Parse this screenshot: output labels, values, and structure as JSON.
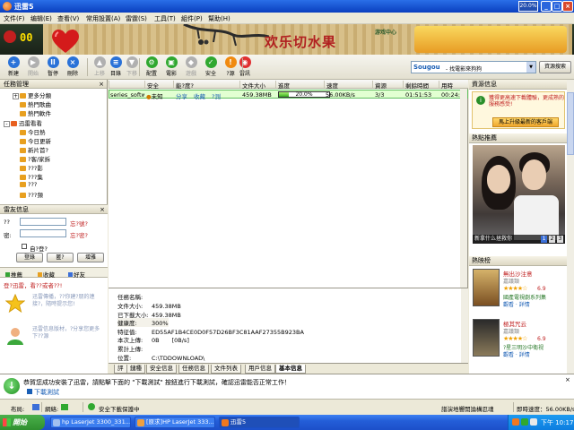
{
  "window": {
    "title": "迅雷5",
    "speed_badge": "20.0%",
    "controls": {
      "minimize": "_",
      "maximize": "□",
      "close": "×"
    }
  },
  "menu": [
    "文件(F)",
    "编辑(E)",
    "查看(V)",
    "常用設置(A)",
    "雷霆(S)",
    "工具(T)",
    "組件(P)",
    "幫助(H)"
  ],
  "banner": {
    "counter": "00",
    "promo_text": "欢乐切水果",
    "promo_tag": "游戏中心"
  },
  "toolbar": {
    "buttons": [
      {
        "label": "新建",
        "icon": "new-icon",
        "color": "#2a72d8",
        "glyph": "+"
      },
      {
        "label": "開始",
        "icon": "start-icon",
        "color": "#b0b0b0",
        "glyph": "▶",
        "disabled": true
      },
      {
        "label": "暫停",
        "icon": "pause-icon",
        "color": "#2a72d8",
        "glyph": "ll"
      },
      {
        "label": "刪除",
        "icon": "delete-icon",
        "color": "#2a72d8",
        "glyph": "×"
      },
      {
        "label": "上移",
        "icon": "move-up-icon",
        "color": "#b0b0b0",
        "glyph": "▲",
        "disabled": true
      },
      {
        "label": "目錄",
        "icon": "folder-icon",
        "color": "#2a72d8",
        "glyph": "≡"
      },
      {
        "label": "下移",
        "icon": "move-down-icon",
        "color": "#b0b0b0",
        "glyph": "▼",
        "disabled": true
      },
      {
        "label": "配置",
        "icon": "config-icon",
        "color": "#30a830",
        "glyph": "⚙"
      },
      {
        "label": "電影",
        "icon": "movie-icon",
        "color": "#30a830",
        "glyph": "▣"
      },
      {
        "label": "遊戲",
        "icon": "game-icon",
        "color": "#b0b0b0",
        "glyph": "◆",
        "disabled": true
      },
      {
        "label": "安全",
        "icon": "security-icon",
        "color": "#30a830",
        "glyph": "✓"
      },
      {
        "label": "?源",
        "icon": "resource-icon",
        "color": "#f08a10",
        "glyph": "!"
      },
      {
        "label": "雷訊",
        "icon": "news-icon",
        "color": "#e03030",
        "glyph": "◉"
      }
    ],
    "search": {
      "brand": "Sougou",
      "placeholder": "- 找電影來狗狗",
      "button": "資源搜索"
    }
  },
  "left": {
    "task_header": "任務管理",
    "tree": [
      {
        "label": "更多分類",
        "expander": "+",
        "color": "#e8a020"
      },
      {
        "label": "熱門歌曲",
        "color": "#e8a020"
      },
      {
        "label": "熱門軟件",
        "color": "#e8a020"
      },
      {
        "label": "迅雷看看",
        "expander": "-",
        "color": "#e86020",
        "root": true
      },
      {
        "label": "今日熱",
        "color": "#e8a020"
      },
      {
        "label": "今日更新",
        "color": "#e8a020"
      },
      {
        "label": "新片首?",
        "color": "#e8a020"
      },
      {
        "label": "?客/家拆",
        "color": "#e8a020"
      },
      {
        "label": "???影",
        "color": "#e8a020"
      },
      {
        "label": "???集",
        "color": "#e8a020"
      },
      {
        "label": "???",
        "color": "#e8a020"
      },
      {
        "label": "???頻",
        "color": "#e8a020"
      }
    ],
    "login": {
      "header": "雷友信息",
      "id_label": "??",
      "pwd_label": "密:",
      "link1": "忘?號?",
      "link2": "忘?密?",
      "remember": "自?登?",
      "buttons": [
        "登錄",
        "匿?",
        "增雅"
      ]
    },
    "friend_tabs": [
      "推薦",
      "收藏",
      "好友"
    ],
    "friend_notice": "登?迅雷，看??或者??!",
    "friend_tip1": "迅雷傳播，??你建?朋的連接?，隨時提示您!",
    "friend_tip2": "迅雷信息版材，?分享您更多下??源"
  },
  "task_table": {
    "headers": [
      "",
      "安全",
      "能?度?",
      "文件大小",
      "進度",
      "速度",
      "資源",
      "剩餘時間",
      "用時"
    ],
    "rows": [
      {
        "name": "series_softwa",
        "security": "未知",
        "share": "分享",
        "collect": "收藏",
        "detect": "?測",
        "size": "459.38MB",
        "progress": 0.2,
        "progress_text": "20.0%",
        "speed": "56.00KB/s",
        "resources": "3/3",
        "remaining": "01:51:53",
        "elapsed": "00:24:53"
      }
    ]
  },
  "details": {
    "task_name_label": "任務名稱:",
    "rows": [
      {
        "k": "文件大小:",
        "v": "459.38MB"
      },
      {
        "k": "已下載大小:",
        "v": "459.38MB"
      },
      {
        "k": "健康度:",
        "v": "300%"
      },
      {
        "k": "特征值:",
        "v": "ED55AF1B4CE0D0F57D26BF3C81AAF27355B923BA"
      },
      {
        "k": "本次上傳:",
        "v": "0B",
        "extra": "[0B/s]"
      },
      {
        "k": "累計上傳:",
        "v": ""
      },
      {
        "k": "位置:",
        "v": "C:\\TDDOWNLOAD\\"
      }
    ],
    "tabs": [
      "評",
      "鏈種",
      "安全信息",
      "任務信息",
      "文件列表",
      "用戶信息",
      "基本信息"
    ]
  },
  "right": {
    "resource_header": "資源信息",
    "update_text": "獲得更高速下載體驗，更成熟的服務感受!",
    "update_button": "馬上升級最新的客戶端",
    "hot_header": "熱點推薦",
    "photo_caption": "新拿什么拯救你",
    "pages": [
      "1",
      "2",
      "3"
    ],
    "rank_header": "熱映榜",
    "rank_items": [
      {
        "title": "無出沙注意",
        "sub": "嘉議類",
        "stars": "★★★★☆",
        "score": "6.9",
        "desc": "國產電視劇系列集",
        "links": "觀看 · 詳情"
      },
      {
        "title": "極其咒云",
        "sub": "嘉議類",
        "stars": "★★★★☆",
        "score": "6.9",
        "desc": "?星三明沙中衛视",
        "links": "觀看 · 詳情"
      }
    ]
  },
  "notification": {
    "text": "恭賀您成功安裝了迅雷，請點擊下面的 \"下載測試\" 按鈕進行下載測試，確認迅雷能否正常工作！",
    "link": "下載測試",
    "close": "×"
  },
  "statusbar": {
    "layout_label": "布局:",
    "network_label": "網絡:",
    "security_text": "安全下載保護中",
    "marquee": "譜演地響開論構忍魂",
    "speed": "即時速度：56.00KB/s"
  },
  "taskbar": {
    "start": "開始",
    "buttons": [
      {
        "label": "hp LaserJet 3300_331...",
        "color": "#a0c0f0"
      },
      {
        "label": "[原求]HP LaserJet 333...",
        "color": "#f0a040"
      },
      {
        "label": "迅雷5",
        "color": "#f07820",
        "active": true
      }
    ],
    "clock": "下午 10:17"
  }
}
